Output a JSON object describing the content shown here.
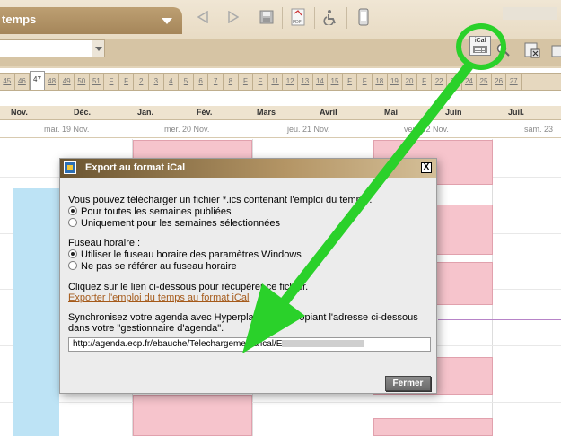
{
  "toolbar": {
    "title_label": "temps",
    "icons": [
      "back-arrow-icon",
      "forward-arrow-icon",
      "save-icon",
      "pdf-icon",
      "accessibility-icon",
      "mobile-icon"
    ],
    "pdf_label": "PDF",
    "ical_label": "iCal"
  },
  "weeks": [
    "45",
    "46",
    "47",
    "48",
    "49",
    "50",
    "51",
    "F",
    "F",
    "2",
    "3",
    "4",
    "5",
    "6",
    "7",
    "8",
    "F",
    "F",
    "11",
    "12",
    "13",
    "14",
    "15",
    "F",
    "F",
    "18",
    "19",
    "20",
    "F",
    "22",
    "23",
    "24",
    "25",
    "26",
    "27"
  ],
  "current_week": "47",
  "months": [
    "Nov.",
    "Déc.",
    "Jan.",
    "Fév.",
    "Mars",
    "Avril",
    "Mai",
    "Juin",
    "Juil."
  ],
  "days": [
    "mar. 19 Nov.",
    "mer. 20 Nov.",
    "jeu. 21 Nov.",
    "ven. 22 Nov.",
    "sam. 23"
  ],
  "dialog": {
    "title": "Export au format iCal",
    "close_label": "X",
    "intro": "Vous pouvez télécharger un fichier *.ics contenant l'emploi du temps :",
    "option_all_weeks": "Pour toutes les semaines publiées",
    "option_selected_weeks": "Uniquement pour les semaines sélectionnées",
    "timezone_label": "Fuseau horaire :",
    "option_windows_tz": "Utiliser le fuseau horaire des paramètres Windows",
    "option_no_tz": "Ne pas se référer au fuseau horaire",
    "click_text": "Cliquez sur le lien ci-dessous pour récupérer ce fichier.",
    "export_link": "Exporter l'emploi du temps au format iCal",
    "sync_text_1": "Synchronisez votre agenda avec Hyperplanning en copiant l'adresse ci-dessous",
    "sync_text_2": "dans votre \"gestionnaire d'agenda\".",
    "url_value": "http://agenda.ecp.fr/ebauche/Telechargements/ical/E",
    "close_button": "Fermer"
  },
  "colors": {
    "annotation_green": "#2ad12a",
    "course_pink": "#f6c4cc",
    "course_blue": "#bde3f5",
    "toolbar_tan": "#a5865a"
  }
}
